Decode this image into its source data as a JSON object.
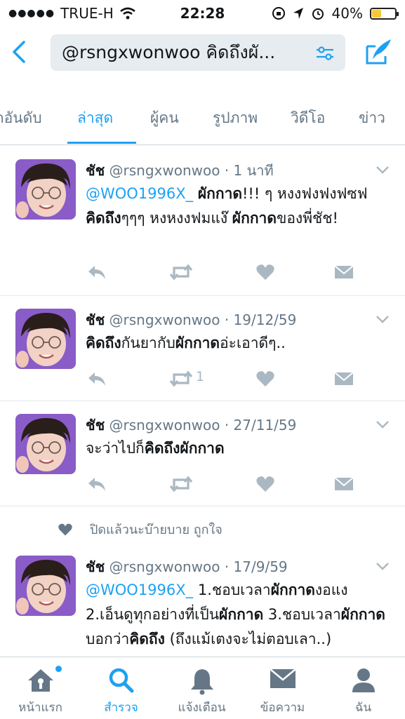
{
  "status": {
    "carrier": "TRUE-H",
    "time": "22:28",
    "battery": "40%",
    "battery_level": 0.4
  },
  "search": {
    "query": "@rsngxwonwoo คิดถึงผั..."
  },
  "tabs": [
    "ิดอันดับ",
    "ล่าสุด",
    "ผู้คน",
    "รูปภาพ",
    "วิดีโอ",
    "ข่าว"
  ],
  "active_tab": 1,
  "tweets": [
    {
      "name": "ชัช",
      "handle": "@rsngxwonwoo",
      "time": "· 1 นาที",
      "parts": [
        {
          "t": "@WOO1996X_",
          "s": "mention"
        },
        {
          "t": " ",
          "s": ""
        },
        {
          "t": "ผักกาด",
          "s": "b"
        },
        {
          "t": "!!! ๆ หงงฟงฟงฟซฟ ",
          "s": ""
        },
        {
          "t": "คิดถึง",
          "s": "b"
        },
        {
          "t": "ๆๆๆ หงหงงฟมแง๊ ",
          "s": ""
        },
        {
          "t": "ผักกาด",
          "s": "b"
        },
        {
          "t": "ของพี่ชัช!",
          "s": ""
        }
      ],
      "retweets": ""
    },
    {
      "name": "ชัช",
      "handle": "@rsngxwonwoo",
      "time": "· 19/12/59",
      "parts": [
        {
          "t": "คิดถึง",
          "s": "b"
        },
        {
          "t": "กันยากับ",
          "s": ""
        },
        {
          "t": "ผักกาด",
          "s": "b"
        },
        {
          "t": "อ่ะเอาดีๆ..",
          "s": ""
        }
      ],
      "retweets": "1"
    },
    {
      "name": "ชัช",
      "handle": "@rsngxwonwoo",
      "time": "· 27/11/59",
      "parts": [
        {
          "t": "จะว่าไปก็",
          "s": ""
        },
        {
          "t": "คิดถึงผักกาด",
          "s": "b"
        }
      ],
      "retweets": ""
    },
    {
      "liked_by": "ปิดแล้วนะบ๊ายบาย ถูกใจ",
      "name": "ชัช",
      "handle": "@rsngxwonwoo",
      "time": "· 17/9/59",
      "parts": [
        {
          "t": "@WOO1996X_",
          "s": "mention"
        },
        {
          "t": " 1.ชอบเวลา",
          "s": ""
        },
        {
          "t": "ผักกาด",
          "s": "b"
        },
        {
          "t": "งอแง 2.เอ็นดูทุกอย่างที่เป็น",
          "s": ""
        },
        {
          "t": "ผักกาด",
          "s": "b"
        },
        {
          "t": " 3.ชอบเวลา",
          "s": ""
        },
        {
          "t": "ผักกาด",
          "s": "b"
        },
        {
          "t": "บอกว่า",
          "s": ""
        },
        {
          "t": "คิดถึง",
          "s": "b"
        },
        {
          "t": " (ถึงแม้เตงจะไม่ตอบเลา..)",
          "s": ""
        }
      ],
      "retweets": ""
    }
  ],
  "tabbar": [
    {
      "label": "หน้าแรก",
      "icon": "home-icon"
    },
    {
      "label": "สำรวจ",
      "icon": "search-icon"
    },
    {
      "label": "แจ้งเตือน",
      "icon": "bell-icon"
    },
    {
      "label": "ข้อความ",
      "icon": "envelope-icon"
    },
    {
      "label": "ฉัน",
      "icon": "person-icon"
    }
  ],
  "colors": {
    "accent": "#1da1f2",
    "muted": "#657786",
    "action": "#aab8c2"
  }
}
